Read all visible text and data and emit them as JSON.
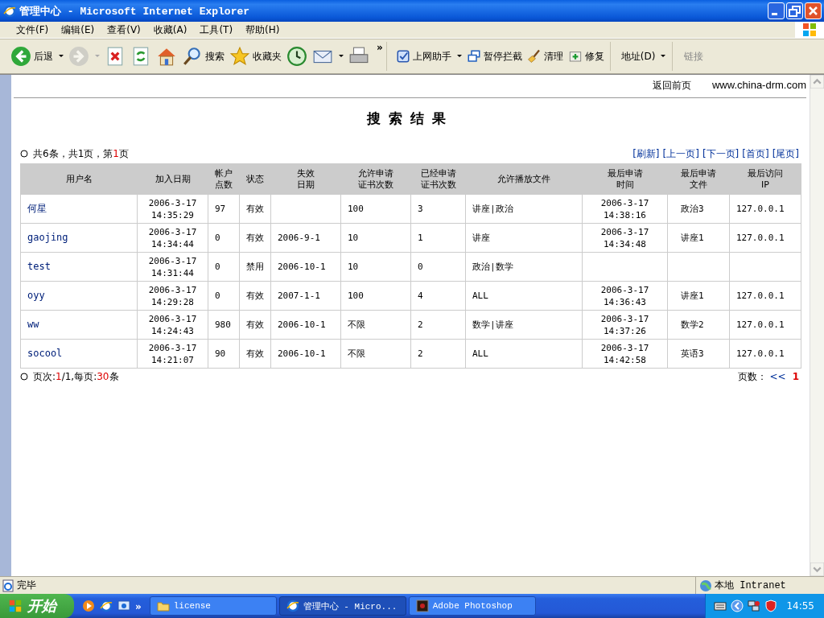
{
  "window": {
    "title": "管理中心 - Microsoft Internet Explorer"
  },
  "menu": [
    "文件(F)",
    "编辑(E)",
    "查看(V)",
    "收藏(A)",
    "工具(T)",
    "帮助(H)"
  ],
  "toolbar": [
    {
      "kind": "back",
      "label": "后退",
      "dropdown": true,
      "disabled": false
    },
    {
      "kind": "forward",
      "dropdown": true,
      "disabled": true
    },
    {
      "kind": "stop",
      "dropdown": false,
      "disabled": false
    },
    {
      "kind": "refresh",
      "dropdown": false,
      "disabled": false
    },
    {
      "kind": "home",
      "dropdown": false,
      "disabled": false
    },
    {
      "kind": "search",
      "label": "搜索",
      "dropdown": false,
      "disabled": false
    },
    {
      "kind": "favorites",
      "label": "收藏夹",
      "dropdown": false,
      "disabled": false
    },
    {
      "kind": "history",
      "dropdown": false,
      "disabled": false
    },
    {
      "kind": "mail",
      "dropdown": true,
      "disabled": false
    },
    {
      "kind": "print",
      "dropdown": false,
      "disabled": false
    }
  ],
  "toolbar2": [
    {
      "kind": "helper",
      "label": "上网助手",
      "dropdown": true
    },
    {
      "kind": "popup",
      "label": "暂停拦截",
      "dropdown": false
    },
    {
      "kind": "broom",
      "label": "清理",
      "dropdown": false
    },
    {
      "kind": "repair",
      "label": "修复",
      "dropdown": false
    }
  ],
  "chevron": "»",
  "address": {
    "label": "地址(D)"
  },
  "links": {
    "label": "链接"
  },
  "page": {
    "back_link": "返回前页",
    "site": "www.china-drm.com",
    "heading": "搜索结果",
    "summary": [
      {
        "text": "共6条，共1页，第",
        "highlight": false
      },
      {
        "text": "1",
        "highlight": true
      },
      {
        "text": "页",
        "highlight": false
      }
    ],
    "nav": [
      "[刷新]",
      "[上一页]",
      "[下一页]",
      "[首页]",
      "[尾页]"
    ],
    "table": {
      "columns": [
        "用户名",
        "加入日期",
        "帐户点数",
        "状态",
        "失效日期",
        "允许申请证书次数",
        "已经申请证书次数",
        "允许播放文件",
        "最后申请时间",
        "最后申请文件",
        "最后访问IP"
      ],
      "rows": [
        [
          "何星",
          "2006-3-17 14:35:29",
          "97",
          "有效",
          "",
          "100",
          "3",
          "讲座|政治",
          "2006-3-17 14:38:16",
          "政治3",
          "127.0.0.1"
        ],
        [
          "gaojing",
          "2006-3-17 14:34:44",
          "0",
          "有效",
          "2006-9-1",
          "10",
          "1",
          "讲座",
          "2006-3-17 14:34:48",
          "讲座1",
          "127.0.0.1"
        ],
        [
          "test",
          "2006-3-17 14:31:44",
          "0",
          "禁用",
          "2006-10-1",
          "10",
          "0",
          "政治|数学",
          "",
          "",
          ""
        ],
        [
          "oyy",
          "2006-3-17 14:29:28",
          "0",
          "有效",
          "2007-1-1",
          "100",
          "4",
          "ALL",
          "2006-3-17 14:36:43",
          "讲座1",
          "127.0.0.1"
        ],
        [
          "ww",
          "2006-3-17 14:24:43",
          "980",
          "有效",
          "2006-10-1",
          "不限",
          "2",
          "数学|讲座",
          "2006-3-17 14:37:26",
          "数学2",
          "127.0.0.1"
        ],
        [
          "socool",
          "2006-3-17 14:21:07",
          "90",
          "有效",
          "2006-10-1",
          "不限",
          "2",
          "ALL",
          "2006-3-17 14:42:58",
          "英语3",
          "127.0.0.1"
        ]
      ]
    },
    "footer": [
      {
        "text": "页次:",
        "highlight": false
      },
      {
        "text": "1",
        "highlight": true
      },
      {
        "text": "/1,每页:",
        "highlight": false
      },
      {
        "text": "30",
        "highlight": true
      },
      {
        "text": "条",
        "highlight": false
      }
    ],
    "pages_label": "页数：",
    "first_link": "<<",
    "current_page": "1"
  },
  "status_bar": {
    "text": "完毕",
    "zone": "本地 Intranet"
  },
  "taskbar": {
    "start": "开始",
    "tasks": [
      {
        "label": "license",
        "kind": "folder",
        "selected": false
      },
      {
        "label": "管理中心 - Micro...",
        "kind": "ie",
        "selected": true
      },
      {
        "label": "Adobe Photoshop",
        "kind": "ps",
        "selected": false
      }
    ],
    "clock": "14:55"
  }
}
